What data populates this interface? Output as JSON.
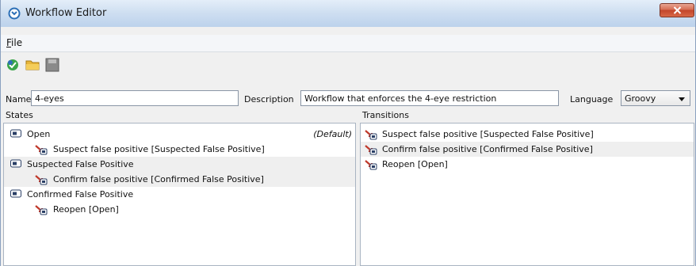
{
  "window": {
    "title": "Workflow Editor",
    "title_icon": "workflow-app-icon",
    "close_icon": "close-icon"
  },
  "menu": {
    "file_mnemonic": "F",
    "file_rest": "ile"
  },
  "toolbar": {
    "icons": [
      "new-icon",
      "open-folder-icon",
      "save-icon"
    ]
  },
  "form": {
    "name_label": "Name",
    "name_value": "4-eyes",
    "description_label": "Description",
    "description_value": "Workflow that enforces the 4-eye restriction",
    "language_label": "Language",
    "language_value": "Groovy"
  },
  "states": {
    "label": "States",
    "items": [
      {
        "label": "Open",
        "tag": "(Default)",
        "transition": "Suspect false positive [Suspected False Positive]"
      },
      {
        "label": "Suspected False Positive",
        "transition": "Confirm false positive [Confirmed False Positive]"
      },
      {
        "label": "Confirmed False Positive",
        "transition": "Reopen [Open]"
      }
    ]
  },
  "transitions": {
    "label": "Transitions",
    "items": [
      "Suspect false positive [Suspected False Positive]",
      "Confirm false positive [Confirmed False Positive]",
      "Reopen [Open]"
    ]
  },
  "colors": {
    "titlebar": "#cfdff1",
    "close": "#c2452a",
    "selection": "#efefef",
    "state_icon": "#2a3f66",
    "transition_arrow": "#c0392b"
  }
}
